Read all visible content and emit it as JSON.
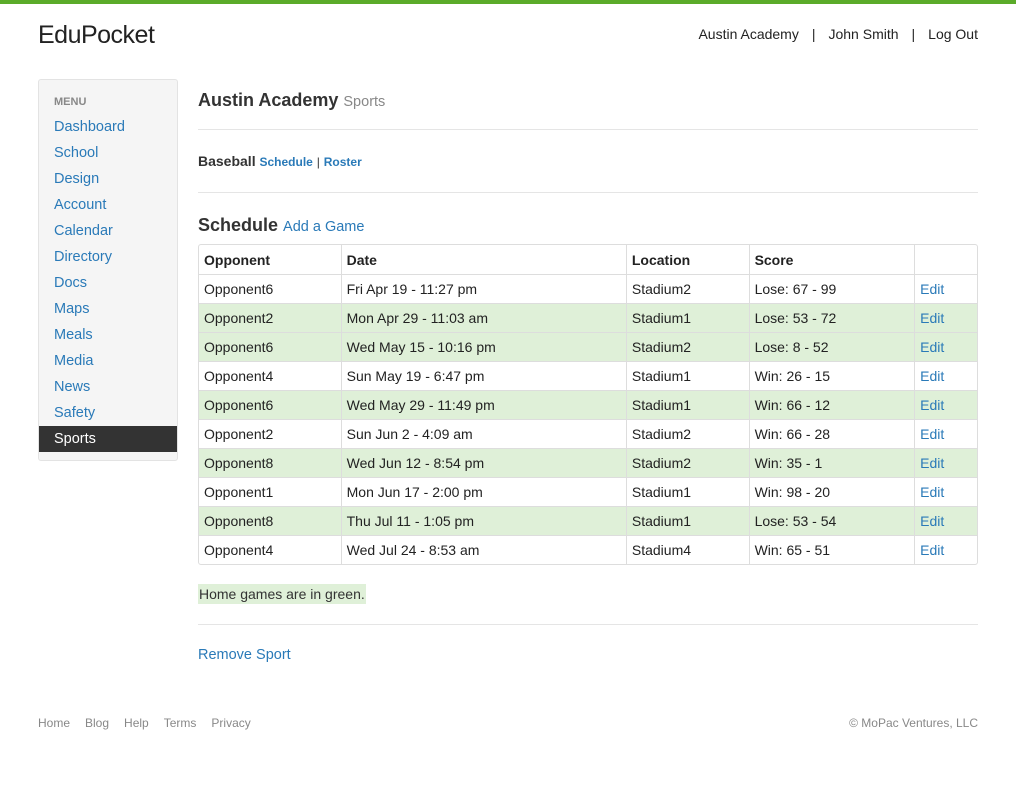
{
  "brand": "EduPocket",
  "user_nav": {
    "school": "Austin Academy",
    "user": "John Smith",
    "logout": "Log Out",
    "separator": "|"
  },
  "sidebar": {
    "menu_label": "MENU",
    "items": [
      {
        "label": "Dashboard"
      },
      {
        "label": "School"
      },
      {
        "label": "Design"
      },
      {
        "label": "Account"
      },
      {
        "label": "Calendar"
      },
      {
        "label": "Directory"
      },
      {
        "label": "Docs"
      },
      {
        "label": "Maps"
      },
      {
        "label": "Meals"
      },
      {
        "label": "Media"
      },
      {
        "label": "News"
      },
      {
        "label": "Safety"
      },
      {
        "label": "Sports",
        "active": true
      }
    ]
  },
  "page": {
    "title": "Austin Academy",
    "subtitle": "Sports"
  },
  "subnav": {
    "sport": "Baseball",
    "schedule_link": "Schedule",
    "separator": "|",
    "roster_link": "Roster"
  },
  "schedule": {
    "title": "Schedule",
    "add_link": "Add a Game",
    "columns": [
      "Opponent",
      "Date",
      "Location",
      "Score",
      ""
    ],
    "rows": [
      {
        "opponent": "Opponent6",
        "date": "Fri Apr 19 - 11:27 pm",
        "location": "Stadium2",
        "score": "Lose: 67 - 99",
        "action": "Edit",
        "home": false
      },
      {
        "opponent": "Opponent2",
        "date": "Mon Apr 29 - 11:03 am",
        "location": "Stadium1",
        "score": "Lose: 53 - 72",
        "action": "Edit",
        "home": true
      },
      {
        "opponent": "Opponent6",
        "date": "Wed May 15 - 10:16 pm",
        "location": "Stadium2",
        "score": "Lose: 8 - 52",
        "action": "Edit",
        "home": true
      },
      {
        "opponent": "Opponent4",
        "date": "Sun May 19 - 6:47 pm",
        "location": "Stadium1",
        "score": "Win: 26 - 15",
        "action": "Edit",
        "home": false
      },
      {
        "opponent": "Opponent6",
        "date": "Wed May 29 - 11:49 pm",
        "location": "Stadium1",
        "score": "Win: 66 - 12",
        "action": "Edit",
        "home": true
      },
      {
        "opponent": "Opponent2",
        "date": "Sun Jun 2 - 4:09 am",
        "location": "Stadium2",
        "score": "Win: 66 - 28",
        "action": "Edit",
        "home": false
      },
      {
        "opponent": "Opponent8",
        "date": "Wed Jun 12 - 8:54 pm",
        "location": "Stadium2",
        "score": "Win: 35 - 1",
        "action": "Edit",
        "home": true
      },
      {
        "opponent": "Opponent1",
        "date": "Mon Jun 17 - 2:00 pm",
        "location": "Stadium1",
        "score": "Win: 98 - 20",
        "action": "Edit",
        "home": false
      },
      {
        "opponent": "Opponent8",
        "date": "Thu Jul 11 - 1:05 pm",
        "location": "Stadium1",
        "score": "Lose: 53 - 54",
        "action": "Edit",
        "home": true
      },
      {
        "opponent": "Opponent4",
        "date": "Wed Jul 24 - 8:53 am",
        "location": "Stadium4",
        "score": "Win: 65 - 51",
        "action": "Edit",
        "home": false
      }
    ]
  },
  "legend": "Home games are in green.",
  "remove_link": "Remove Sport",
  "footer": {
    "links": [
      "Home",
      "Blog",
      "Help",
      "Terms",
      "Privacy"
    ],
    "copyright": "© MoPac Ventures, LLC"
  },
  "colors": {
    "accent_bar": "#5bab2a",
    "link": "#2a7ab8",
    "home_row": "#dff0d8",
    "active_nav": "#333333"
  }
}
